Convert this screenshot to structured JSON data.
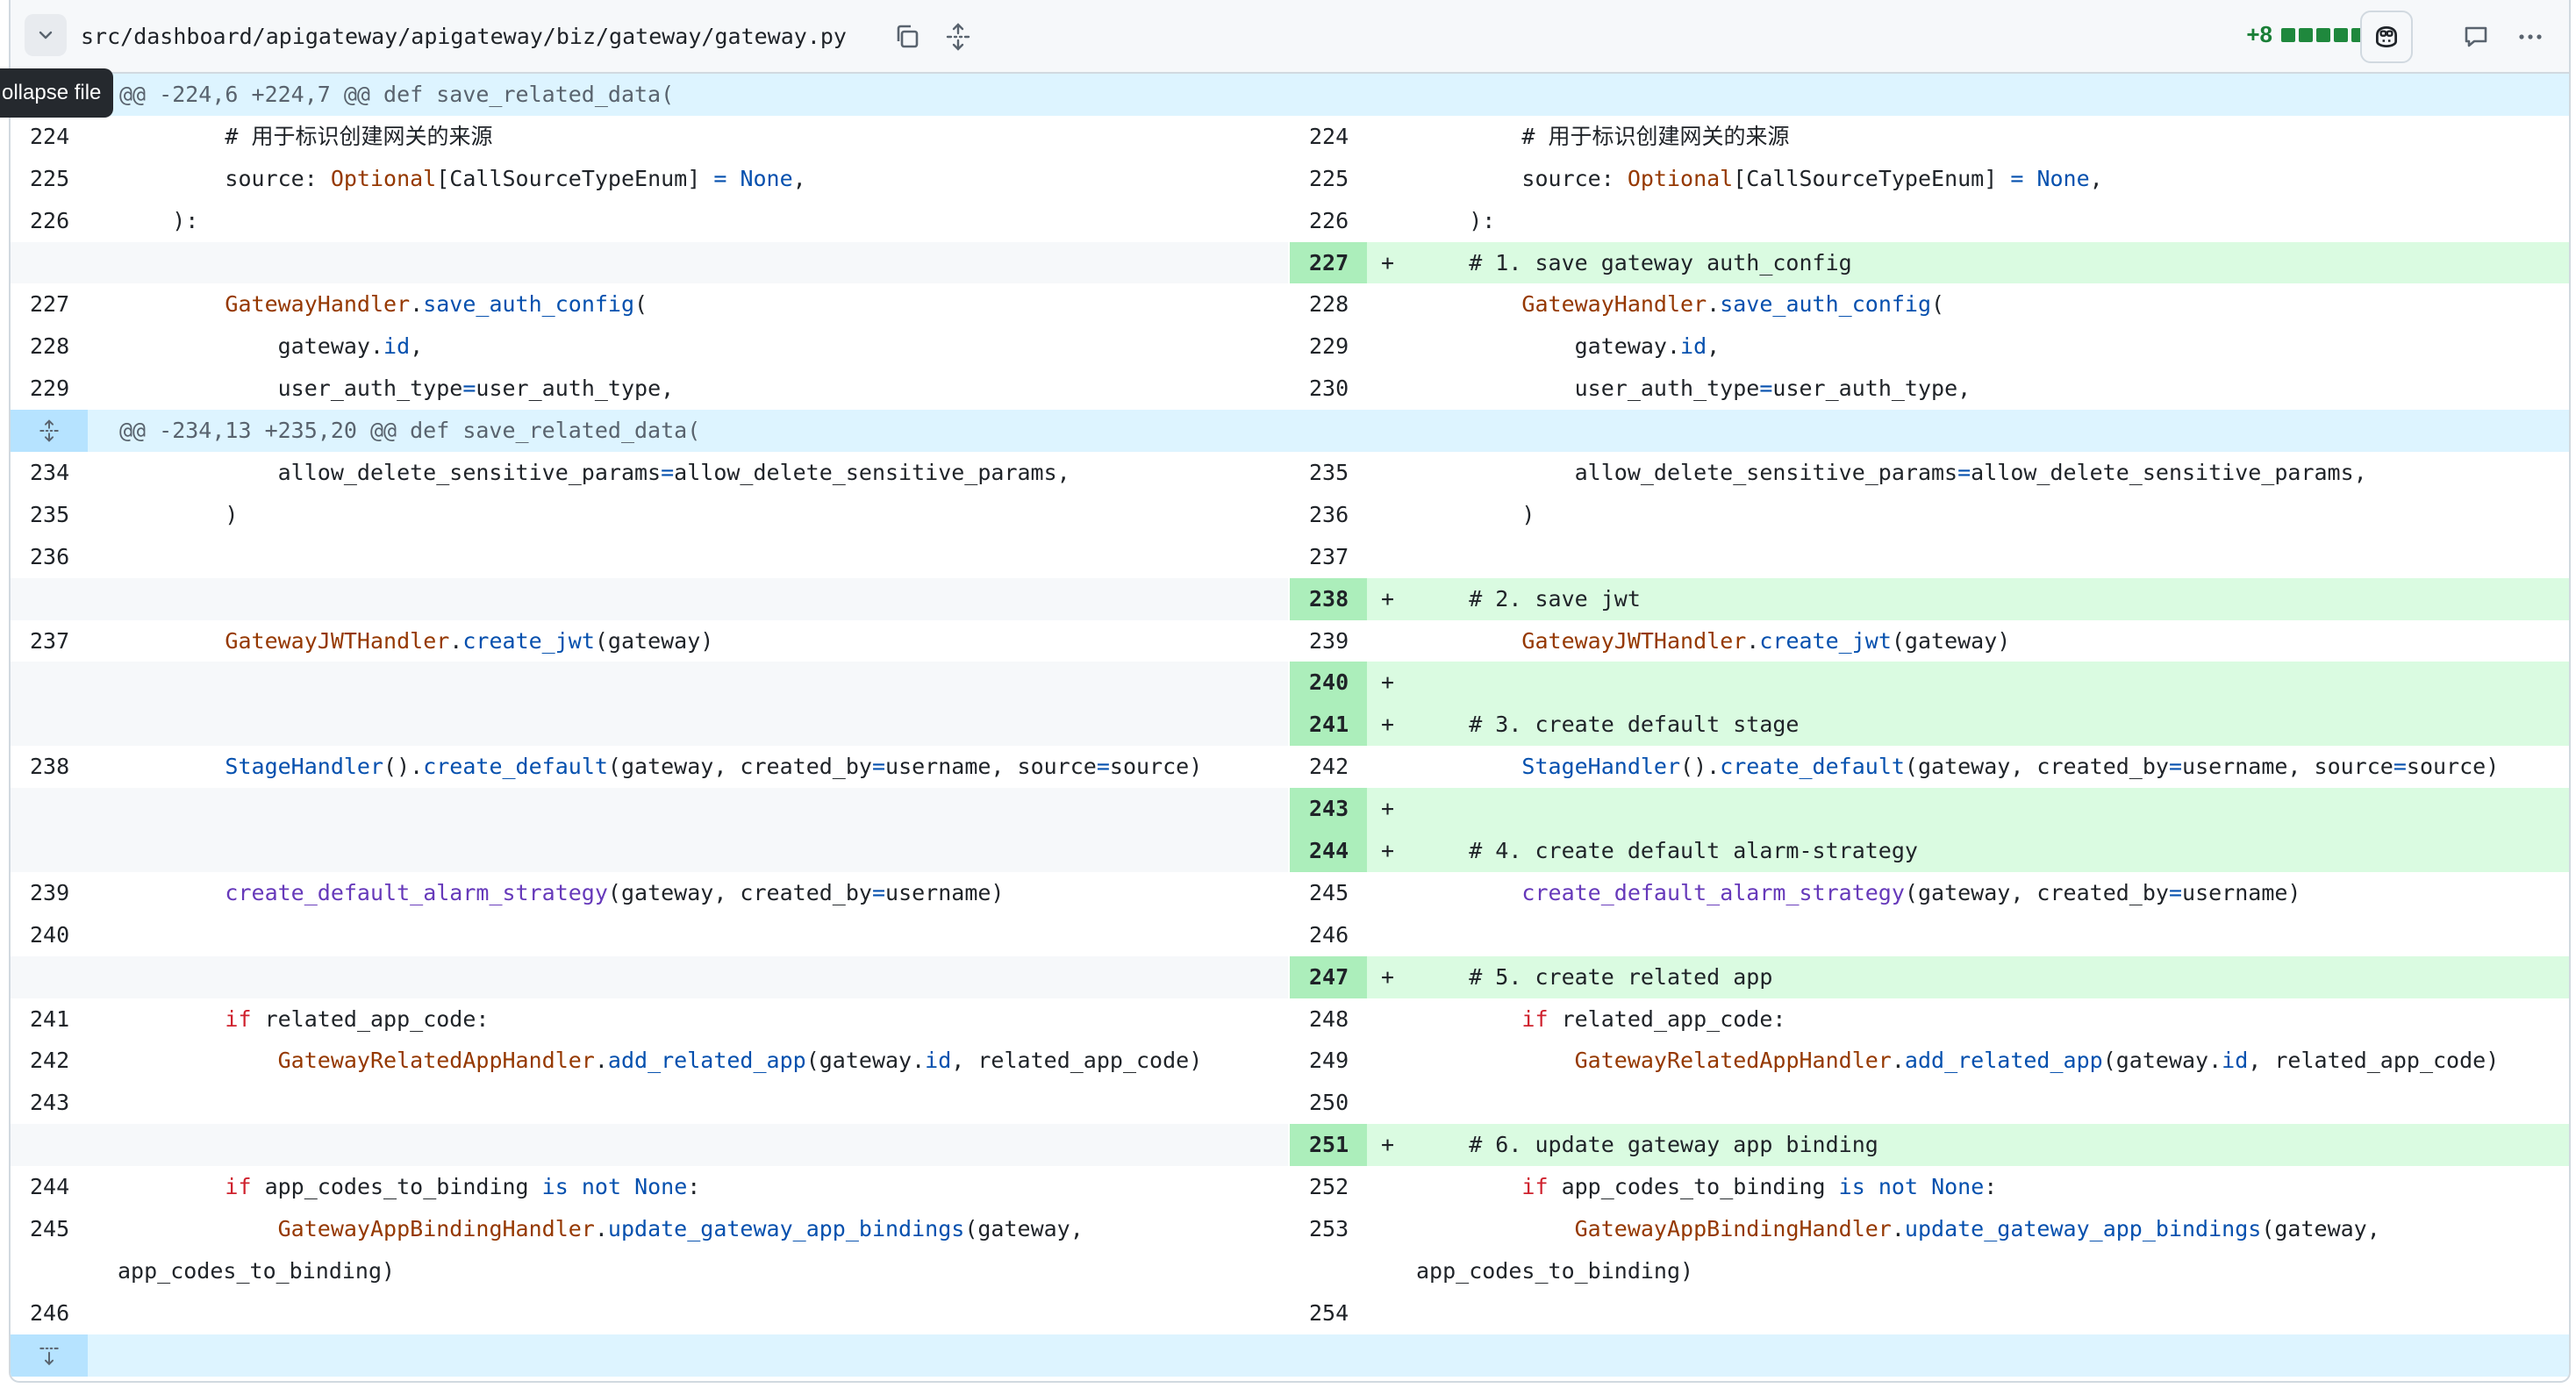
{
  "header": {
    "file_path": "src/dashboard/apigateway/apigateway/biz/gateway/gateway.py",
    "additions": "+8",
    "tooltip": "Collapse file",
    "tooltip_visible": "ollapse file"
  },
  "colors": {
    "addition_bg": "#dafbe1",
    "addition_num_bg": "#aceebb",
    "hunk_bg": "#ddf4ff",
    "keyword": "#cf222e",
    "function": "#6639ba",
    "class": "#953800"
  },
  "icons": {
    "collapse": "chevron-down-icon",
    "copy": "copy-icon",
    "expand": "unfold-icon",
    "copilot": "copilot-icon",
    "comment": "comment-icon",
    "more": "kebab-icon"
  },
  "hunks": [
    {
      "text": "@@ -224,6 +224,7 @@ def save_related_data("
    },
    {
      "text": "@@ -234,13 +235,20 @@ def save_related_data("
    }
  ],
  "lines": [
    {
      "l": "224",
      "r": "224",
      "lcode": "        # 用于标识创建网关的来源",
      "rcode": "        # 用于标识创建网关的来源"
    },
    {
      "l": "225",
      "r": "225",
      "lcode": "        source: Optional[CallSourceTypeEnum] = None,",
      "rcode": "        source: Optional[CallSourceTypeEnum] = None,"
    },
    {
      "l": "226",
      "r": "226",
      "lcode": "    ):",
      "rcode": "    ):"
    },
    {
      "l": "",
      "r": "227",
      "rcode": "    # 1. save gateway auth_config"
    },
    {
      "l": "227",
      "r": "228",
      "lcode": "        GatewayHandler.save_auth_config(",
      "rcode": "        GatewayHandler.save_auth_config("
    },
    {
      "l": "228",
      "r": "229",
      "lcode": "            gateway.id,",
      "rcode": "            gateway.id,"
    },
    {
      "l": "229",
      "r": "230",
      "lcode": "            user_auth_type=user_auth_type,",
      "rcode": "            user_auth_type=user_auth_type,"
    },
    {
      "l": "234",
      "r": "235",
      "lcode": "            allow_delete_sensitive_params=allow_delete_sensitive_params,",
      "rcode": "            allow_delete_sensitive_params=allow_delete_sensitive_params,"
    },
    {
      "l": "235",
      "r": "236",
      "lcode": "        )",
      "rcode": "        )"
    },
    {
      "l": "236",
      "r": "237",
      "lcode": "",
      "rcode": ""
    },
    {
      "l": "",
      "r": "238",
      "rcode": "    # 2. save jwt"
    },
    {
      "l": "237",
      "r": "239",
      "lcode": "        GatewayJWTHandler.create_jwt(gateway)",
      "rcode": "        GatewayJWTHandler.create_jwt(gateway)"
    },
    {
      "l": "",
      "r": "240",
      "rcode": ""
    },
    {
      "l": "",
      "r": "241",
      "rcode": "    # 3. create default stage"
    },
    {
      "l": "238",
      "r": "242",
      "lcode": "        StageHandler().create_default(gateway, created_by=username, source=source)",
      "rcode": "        StageHandler().create_default(gateway, created_by=username, source=source)"
    },
    {
      "l": "",
      "r": "243",
      "rcode": ""
    },
    {
      "l": "",
      "r": "244",
      "rcode": "    # 4. create default alarm-strategy"
    },
    {
      "l": "239",
      "r": "245",
      "lcode": "        create_default_alarm_strategy(gateway, created_by=username)",
      "rcode": "        create_default_alarm_strategy(gateway, created_by=username)"
    },
    {
      "l": "240",
      "r": "246",
      "lcode": "",
      "rcode": ""
    },
    {
      "l": "",
      "r": "247",
      "rcode": "    # 5. create related app"
    },
    {
      "l": "241",
      "r": "248",
      "lcode": "        if related_app_code:",
      "rcode": "        if related_app_code:"
    },
    {
      "l": "242",
      "r": "249",
      "lcode": "            GatewayRelatedAppHandler.add_related_app(gateway.id, related_app_code)",
      "rcode": "            GatewayRelatedAppHandler.add_related_app(gateway.id, related_app_code)"
    },
    {
      "l": "243",
      "r": "250",
      "lcode": "",
      "rcode": ""
    },
    {
      "l": "",
      "r": "251",
      "rcode": "    # 6. update gateway app binding"
    },
    {
      "l": "244",
      "r": "252",
      "lcode": "        if app_codes_to_binding is not None:",
      "rcode": "        if app_codes_to_binding is not None:"
    },
    {
      "l": "245",
      "r": "253",
      "lcode": "            GatewayAppBindingHandler.update_gateway_app_bindings(gateway,",
      "rcode": "            GatewayAppBindingHandler.update_gateway_app_bindings(gateway,"
    },
    {
      "l": "",
      "r": "",
      "lcode": "app_codes_to_binding)",
      "rcode": "app_codes_to_binding)"
    },
    {
      "l": "246",
      "r": "254",
      "lcode": "",
      "rcode": ""
    }
  ]
}
